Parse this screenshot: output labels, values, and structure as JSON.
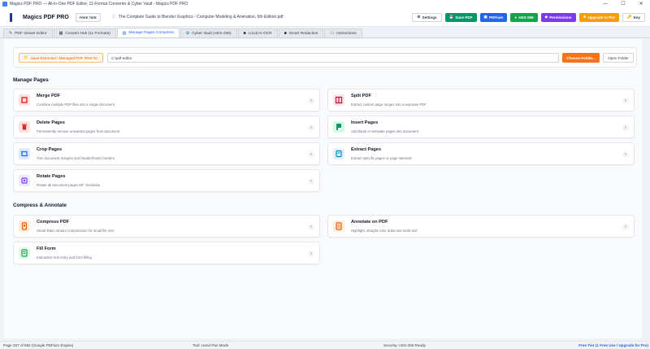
{
  "window": {
    "title": "Magics PDF PRO — All-in-One PDF Editor, 11-Format Converter & Cyber Vault - Magics PDF PRO",
    "minimize": "—",
    "maximize": "☐",
    "close": "✕"
  },
  "toolbar": {
    "app_name": "Magics PDF PRO",
    "tier_badge": "FREE TIER",
    "doc_title": "The Complete Guide to Blender Graphics - Computer Modeling & Animation, 6th Edition.pdf",
    "settings": "Settings",
    "save_pdf": "Save PDF",
    "pdfium": "PDFium",
    "aes": "AES-256",
    "permissions": "Permissions",
    "upgrade": "Upgrade to Pro",
    "key": "Key"
  },
  "tabs": [
    {
      "label": "PDF Viewer Editor",
      "icon": "✎"
    },
    {
      "label": "Convert Hub (11 Formats)",
      "icon": "▦"
    },
    {
      "label": "Manage Pages Compress",
      "icon": "▤"
    },
    {
      "label": "Cyber Vault (AES-256)",
      "icon": "✿"
    },
    {
      "label": "Local AI OCR",
      "icon": "■"
    },
    {
      "label": "Smart Redaction",
      "icon": "■"
    },
    {
      "label": "Instructions",
      "icon": "▭"
    }
  ],
  "folder": {
    "label": "Save Extracted / Managed PDF Files To:",
    "path": "C:\\pdf-editor",
    "choose": "Choose Folder...",
    "open": "Open Folder"
  },
  "sections": {
    "manage": "Manage Pages",
    "compress": "Compress & Annotate"
  },
  "cards": {
    "merge": {
      "title": "Merge PDF",
      "desc": "Combine multiple PDF files into a single document",
      "color": "#dc2626"
    },
    "split": {
      "title": "Split PDF",
      "desc": "Extract custom page ranges into a separate PDF",
      "color": "#be123c"
    },
    "delete": {
      "title": "Delete Pages",
      "desc": "Permanently remove unwanted pages from document",
      "color": "#dc2626"
    },
    "insert": {
      "title": "Insert Pages",
      "desc": "Add blank or template pages into document",
      "color": "#059669"
    },
    "crop": {
      "title": "Crop Pages",
      "desc": "Trim document margins and header/footer borders",
      "color": "#2563eb"
    },
    "extract": {
      "title": "Extract Pages",
      "desc": "Extract specific pages or page intervals",
      "color": "#0284c7"
    },
    "rotate": {
      "title": "Rotate Pages",
      "desc": "Rotate all document pages 90° clockwise",
      "color": "#7c3aed"
    },
    "compress": {
      "title": "Compress PDF",
      "desc": "Smart Ratio stream compression for small file size",
      "color": "#ea580c"
    },
    "annotate": {
      "title": "Annotate on PDF",
      "desc": "Highlight, straight color draw and mark text",
      "color": "#ea580c"
    },
    "fill": {
      "title": "Fill Form",
      "desc": "Interactive text entry and form filling",
      "color": "#16a34a"
    },
    "chevron": "›"
  },
  "status": {
    "page": "Page 337 of 592 (Google PDFium Engine)",
    "tool": "Tool: Hand Pan Mode",
    "security": "Security: AES-256 Ready",
    "tier": "Free Tier (1 Free Use / Upgrade for Pro)"
  }
}
